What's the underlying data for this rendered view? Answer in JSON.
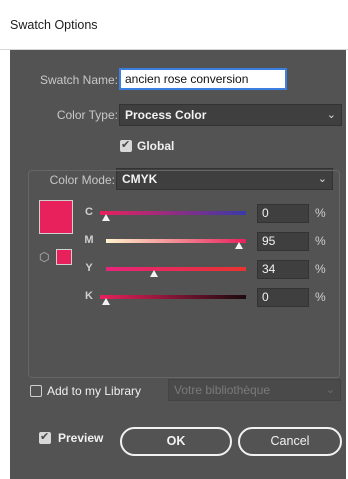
{
  "window": {
    "title": "Swatch Options"
  },
  "form": {
    "swatch_name_label": "Swatch Name:",
    "swatch_name_value": "ancien rose conversion",
    "color_type_label": "Color Type:",
    "color_type_value": "Process Color",
    "global_label": "Global",
    "global_checked": true,
    "color_mode_label": "Color Mode:",
    "color_mode_value": "CMYK"
  },
  "swatch_color": "#e8215c",
  "channels": [
    {
      "key": "C",
      "value": "0",
      "unit": "%",
      "level": 0.0
    },
    {
      "key": "M",
      "value": "95",
      "unit": "%",
      "level": 0.95
    },
    {
      "key": "Y",
      "value": "34",
      "unit": "%",
      "level": 0.34
    },
    {
      "key": "K",
      "value": "0",
      "unit": "%",
      "level": 0.0
    }
  ],
  "library": {
    "add_label": "Add to my Library",
    "add_checked": false,
    "select_value": "Votre bibliothèque"
  },
  "footer": {
    "preview_label": "Preview",
    "preview_checked": true,
    "ok_label": "OK",
    "cancel_label": "Cancel"
  },
  "icons": {
    "dropdown": "chevron-down-icon",
    "out_of_gamut": "cube-icon"
  }
}
